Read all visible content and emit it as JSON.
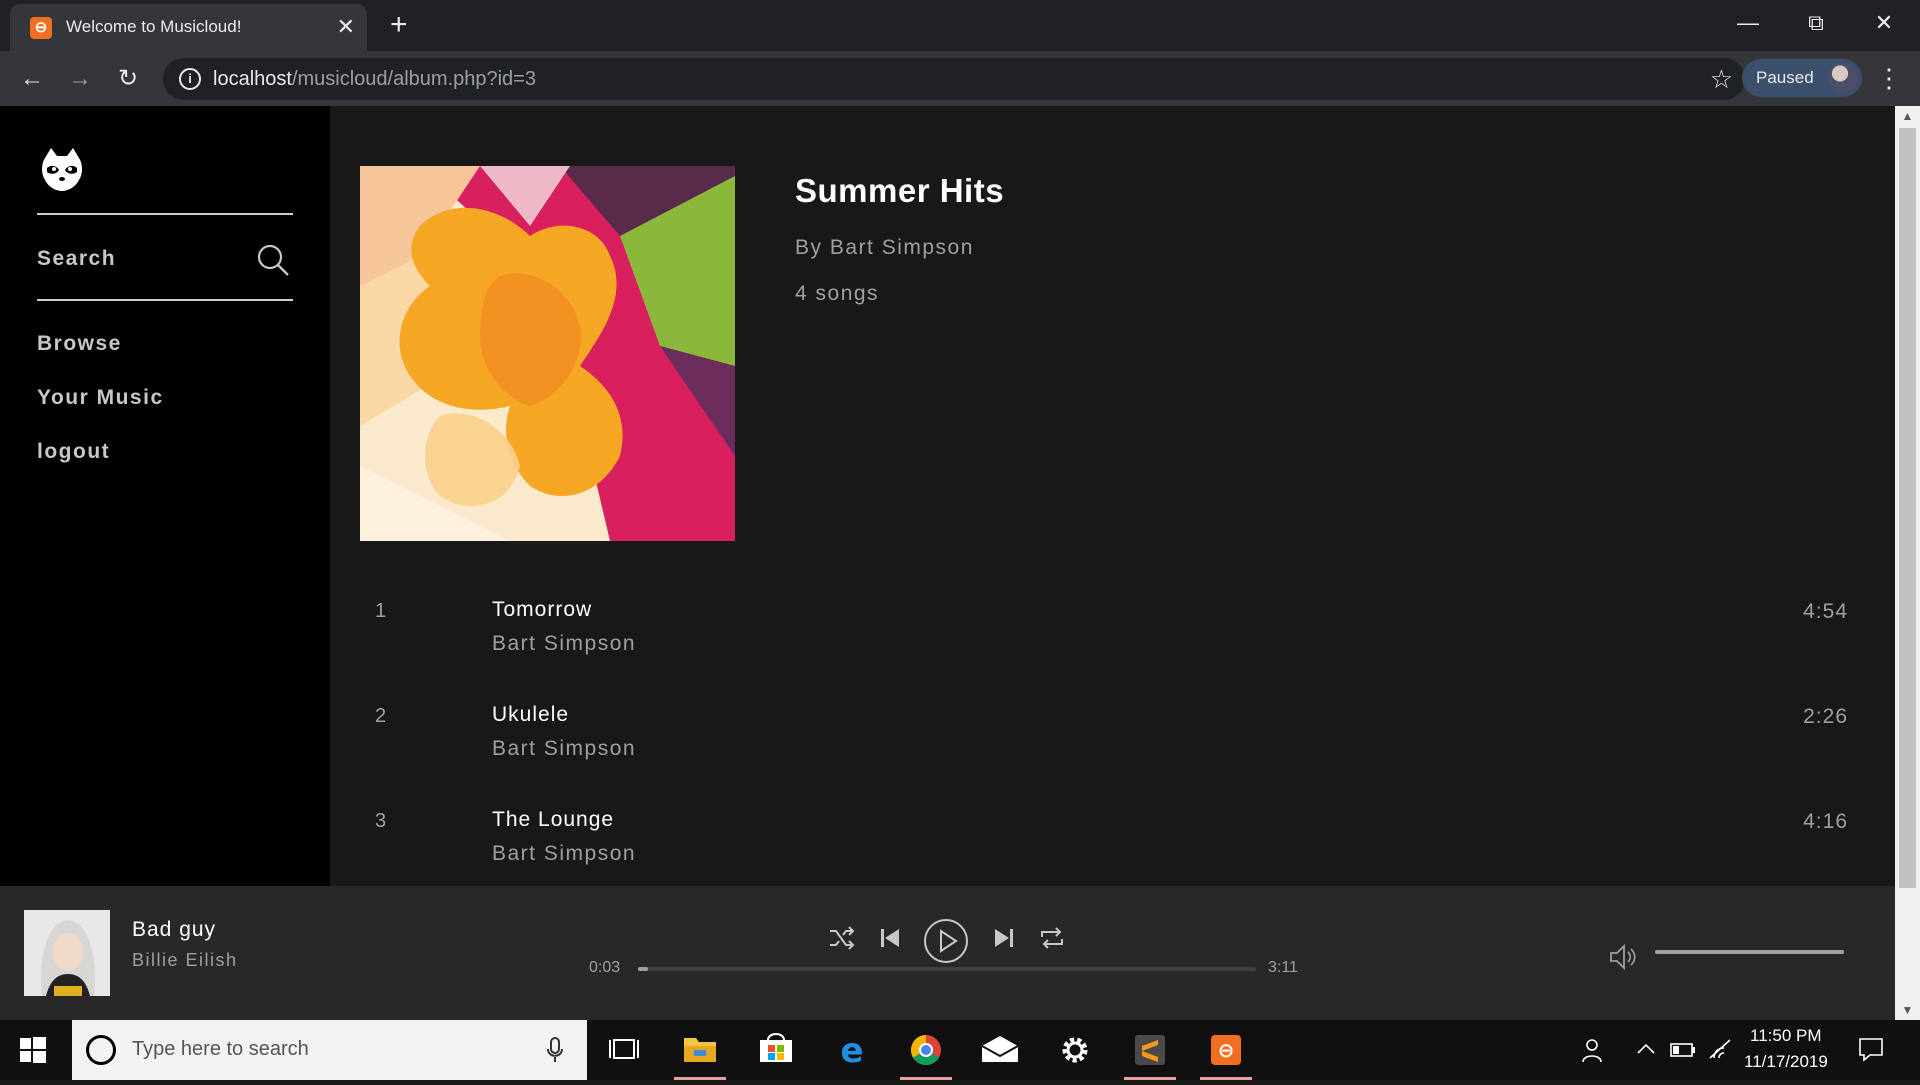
{
  "browser": {
    "tab_title": "Welcome to Musicloud!",
    "url_host": "localhost",
    "url_path": "/musicloud/album.php?id=3",
    "profile_label": "Paused"
  },
  "sidebar": {
    "search_label": "Search",
    "items": [
      {
        "label": "Browse"
      },
      {
        "label": "Your Music"
      },
      {
        "label": "logout"
      }
    ]
  },
  "album": {
    "title": "Summer Hits",
    "artist": "By Bart Simpson",
    "song_count": "4 songs",
    "tracks": [
      {
        "num": "1",
        "name": "Tomorrow",
        "artist": "Bart Simpson",
        "duration": "4:54"
      },
      {
        "num": "2",
        "name": "Ukulele",
        "artist": "Bart Simpson",
        "duration": "2:26"
      },
      {
        "num": "3",
        "name": "The Lounge",
        "artist": "Bart Simpson",
        "duration": "4:16"
      }
    ]
  },
  "player": {
    "title": "Bad guy",
    "artist": "Billie Eilish",
    "time_current": "0:03",
    "time_total": "3:11",
    "progress_fraction": 0.016,
    "volume_fraction": 1.0
  },
  "taskbar": {
    "search_placeholder": "Type here to search",
    "clock_time": "11:50 PM",
    "clock_date": "11/17/2019"
  },
  "icons": {
    "logo": "raccoon-logo-icon",
    "search": "search-icon",
    "shuffle": "shuffle-icon",
    "previous": "previous-icon",
    "play": "play-icon",
    "next": "next-icon",
    "repeat": "repeat-icon",
    "volume": "volume-icon"
  },
  "colors": {
    "sidebar_bg": "#000000",
    "main_bg": "#181818",
    "player_bg": "#282828",
    "favicon": "#f26f21"
  }
}
